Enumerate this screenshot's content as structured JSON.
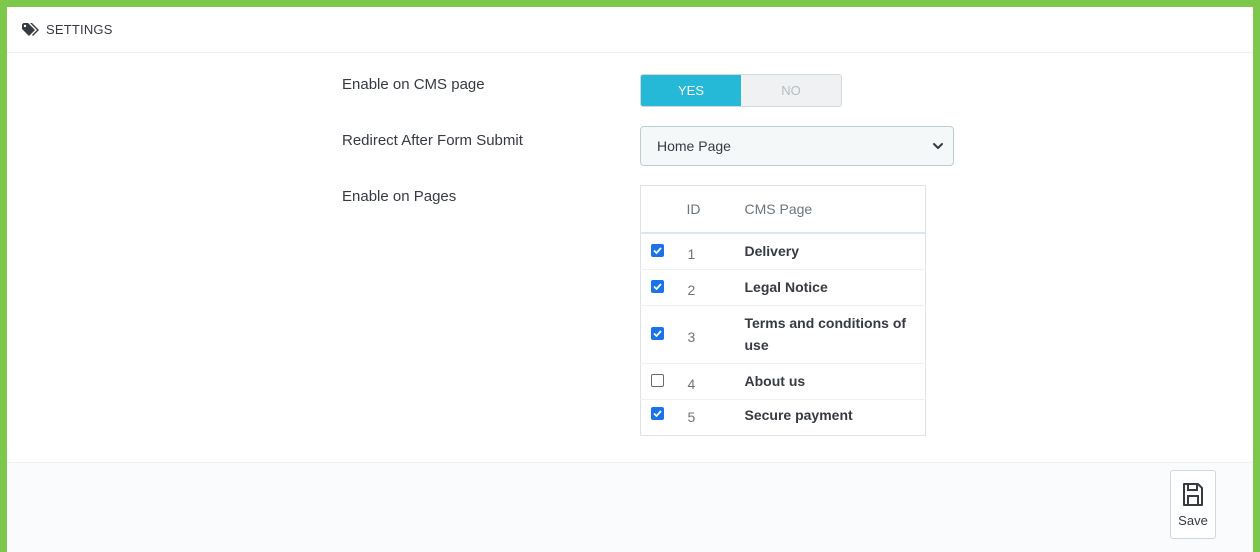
{
  "panel": {
    "title": "SETTINGS",
    "icon": "tags-icon"
  },
  "form": {
    "enable_cms": {
      "label": "Enable on CMS page",
      "yes_label": "YES",
      "no_label": "NO",
      "value": "YES"
    },
    "redirect": {
      "label": "Redirect After Form Submit",
      "selected": "Home Page"
    },
    "pages": {
      "label": "Enable on Pages",
      "columns": [
        "",
        "ID",
        "CMS Page"
      ],
      "rows": [
        {
          "checked": true,
          "id": "1",
          "name": "Delivery"
        },
        {
          "checked": true,
          "id": "2",
          "name": "Legal Notice"
        },
        {
          "checked": true,
          "id": "3",
          "name": "Terms and conditions of use"
        },
        {
          "checked": false,
          "id": "4",
          "name": "About us"
        },
        {
          "checked": true,
          "id": "5",
          "name": "Secure payment"
        }
      ]
    }
  },
  "footer": {
    "save_label": "Save",
    "save_icon": "floppy-disk-icon"
  },
  "colors": {
    "border_accent": "#7dc74a",
    "switch_active": "#25b9d7",
    "checkbox": "#1a73e8"
  }
}
